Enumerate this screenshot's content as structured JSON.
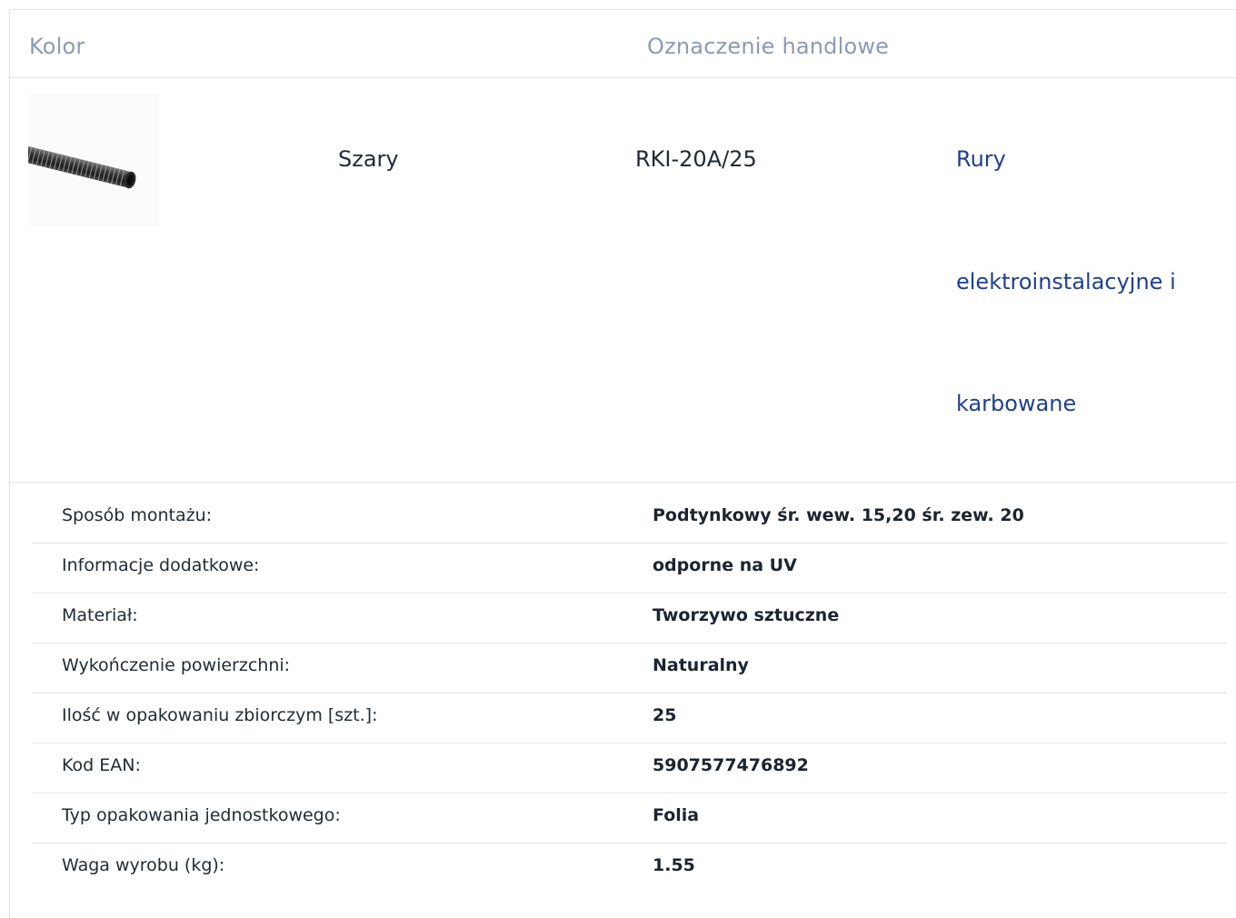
{
  "table": {
    "headers": {
      "color": "Kolor",
      "trade_name": "Oznaczenie handlowe"
    },
    "product": {
      "image_icon": "corrugated-pipe-image",
      "color": "Szary",
      "trade_name": "RKI-20A/25",
      "category_lines": [
        "Rury",
        "elektroinstalacyjne i",
        "karbowane"
      ]
    }
  },
  "specs": [
    {
      "label": "Sposób montażu:",
      "value": "Podtynkowy śr. wew. 15,20 śr. zew. 20"
    },
    {
      "label": "Informacje dodatkowe:",
      "value": "odporne na UV"
    },
    {
      "label": "Materiał:",
      "value": "Tworzywo sztuczne"
    },
    {
      "label": "Wykończenie powierzchni:",
      "value": "Naturalny"
    },
    {
      "label": "Ilość w opakowaniu zbiorczym [szt.]:",
      "value": "25"
    },
    {
      "label": "Kod EAN:",
      "value": "5907577476892"
    },
    {
      "label": "Typ opakowania jednostkowego:",
      "value": "Folia"
    },
    {
      "label": "Waga wyrobu (kg):",
      "value": "1.55"
    }
  ],
  "colors": {
    "header_text": "#8b9ab8",
    "link": "#1f3f8f",
    "body_text": "#222b36",
    "divider": "#e2e5ea"
  }
}
